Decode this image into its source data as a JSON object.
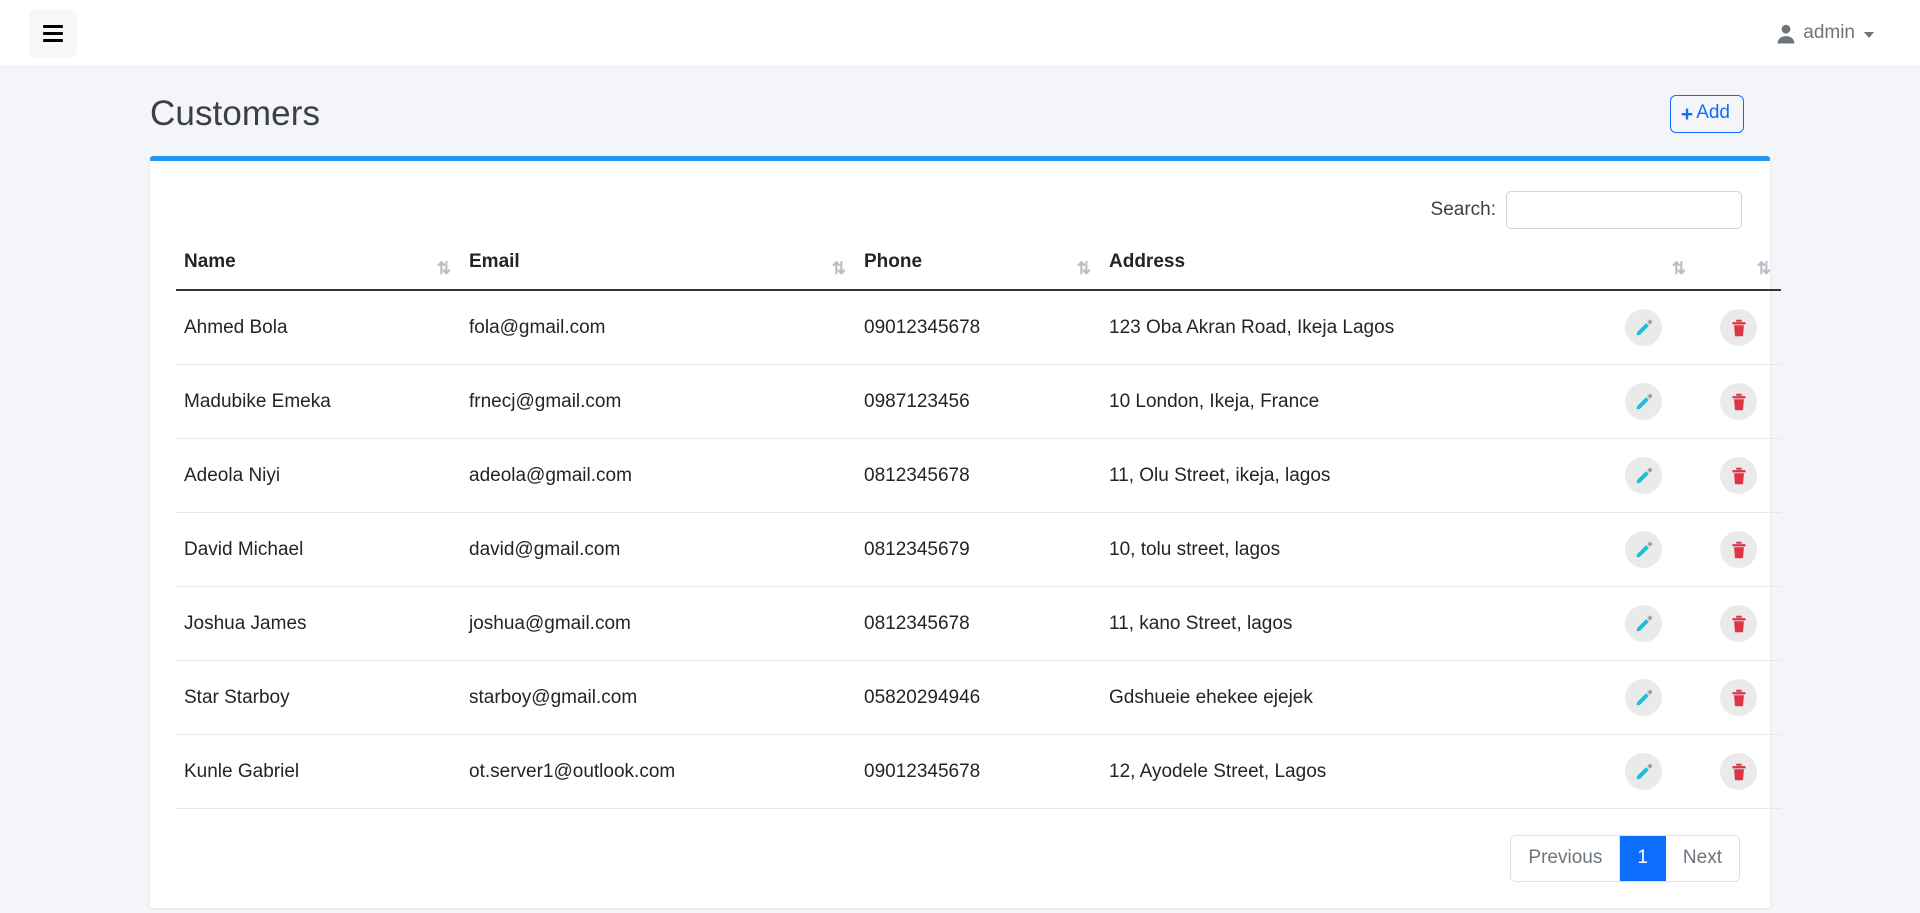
{
  "navbar": {
    "menu_toggle_icon": "hamburger-icon",
    "user": {
      "icon": "user-icon",
      "name": "admin",
      "caret_icon": "caret-down-icon"
    }
  },
  "page": {
    "title": "Customers",
    "add_button": {
      "icon": "plus-icon",
      "plus": "+",
      "label": "Add"
    }
  },
  "search": {
    "label": "Search:",
    "value": "",
    "placeholder": ""
  },
  "table": {
    "columns": [
      {
        "key": "name",
        "label": "Name",
        "sortable": true,
        "sort_icon": "sort-icon"
      },
      {
        "key": "email",
        "label": "Email",
        "sortable": true,
        "sort_icon": "sort-icon"
      },
      {
        "key": "phone",
        "label": "Phone",
        "sortable": true,
        "sort_icon": "sort-icon"
      },
      {
        "key": "address",
        "label": "Address",
        "sortable": true,
        "sort_icon": "sort-icon"
      },
      {
        "key": "edit",
        "label": "",
        "sortable": true,
        "sort_icon": "sort-icon"
      },
      {
        "key": "delete",
        "label": "",
        "sortable": true,
        "sort_icon": "sort-icon"
      }
    ],
    "sort_glyph": "⇅",
    "rows": [
      {
        "name": "Ahmed Bola",
        "email": "fola@gmail.com",
        "phone": "09012345678",
        "address": "123 Oba Akran Road, Ikeja Lagos",
        "edit_icon": "pencil-icon",
        "delete_icon": "trash-icon"
      },
      {
        "name": "Madubike Emeka",
        "email": "frnecj@gmail.com",
        "phone": "0987123456",
        "address": "10 London, Ikeja, France",
        "edit_icon": "pencil-icon",
        "delete_icon": "trash-icon"
      },
      {
        "name": "Adeola Niyi",
        "email": "adeola@gmail.com",
        "phone": "0812345678",
        "address": "11, Olu Street, ikeja, lagos",
        "edit_icon": "pencil-icon",
        "delete_icon": "trash-icon"
      },
      {
        "name": "David Michael",
        "email": "david@gmail.com",
        "phone": "0812345679",
        "address": "10, tolu street, lagos",
        "edit_icon": "pencil-icon",
        "delete_icon": "trash-icon"
      },
      {
        "name": "Joshua James",
        "email": "joshua@gmail.com",
        "phone": "0812345678",
        "address": "11, kano Street, lagos",
        "edit_icon": "pencil-icon",
        "delete_icon": "trash-icon"
      },
      {
        "name": "Star Starboy",
        "email": "starboy@gmail.com",
        "phone": "05820294946",
        "address": "Gdshueie ehekee ejejek",
        "edit_icon": "pencil-icon",
        "delete_icon": "trash-icon"
      },
      {
        "name": "Kunle Gabriel",
        "email": "ot.server1@outlook.com",
        "phone": "09012345678",
        "address": "12, Ayodele Street, Lagos",
        "edit_icon": "pencil-icon",
        "delete_icon": "trash-icon"
      }
    ]
  },
  "pagination": {
    "previous_label": "Previous",
    "pages": [
      "1"
    ],
    "active_page": "1",
    "next_label": "Next"
  },
  "colors": {
    "accent_blue": "#0d6efd",
    "card_top_border": "#2196f3",
    "edit_icon": "#17bfe0",
    "delete_icon": "#dc3545",
    "page_background": "#f4f5f9",
    "muted_text": "#6c757d"
  }
}
